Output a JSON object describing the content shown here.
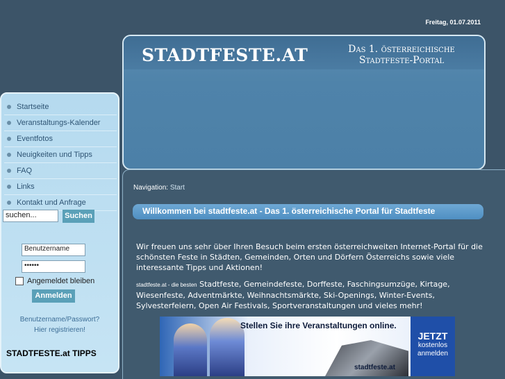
{
  "date": "Freitag, 01.07.2011",
  "header": {
    "logo": "STADTFESTE.AT",
    "tagline_line1": "Das 1. österreichische",
    "tagline_line2": "Stadtfeste-Portal"
  },
  "sidebar": {
    "menu": [
      {
        "label": "Startseite"
      },
      {
        "label": "Veranstaltungs-Kalender"
      },
      {
        "label": "Eventfotos"
      },
      {
        "label": "Neuigkeiten und Tipps"
      },
      {
        "label": "FAQ"
      },
      {
        "label": "Links"
      },
      {
        "label": "Kontakt und Anfrage"
      }
    ],
    "search": {
      "value": "suchen...",
      "button": "Suchen"
    },
    "login": {
      "username": "Benutzername",
      "password": "••••••",
      "remember": "Angemeldet bleiben",
      "button": "Anmelden",
      "forgot_line1": "Benutzername/Passwort?",
      "forgot_line2": "Hier registrieren!"
    },
    "tips": "STADTFESTE.at TIPPS"
  },
  "content": {
    "breadcrumb_label": "Navigation:",
    "breadcrumb_current": "Start",
    "welcome": "Willkommen bei stadtfeste.at - Das 1. österreichische Portal für Stadtfeste",
    "intro": "Wir freuen uns sehr über Ihren Besuch beim ersten österreichweiten Internet-Portal für die schönsten Feste in Städten, Gemeinden, Orten und Dörfern Österreichs sowie viele interessante Tipps und Aktionen!",
    "intro2_prefix": "stadtfeste.at - die besten",
    "intro2_text": "Stadtfeste, Gemeindefeste, Dorffeste, Faschingsumzüge, Kirtage, Wiesenfeste, Adventmärkte, Weihnachtsmärkte, Ski-Openings, Winter-Events, Sylvesterfeiern, Open Air Festivals, Sportveranstaltungen und vieles mehr!",
    "banner": {
      "headline": "Stellen Sie ihre Veranstaltungen online.",
      "brand": "stadtfeste.at",
      "cta_big": "JETZT",
      "cta_line1": "kostenlos",
      "cta_line2": "anmelden"
    }
  }
}
